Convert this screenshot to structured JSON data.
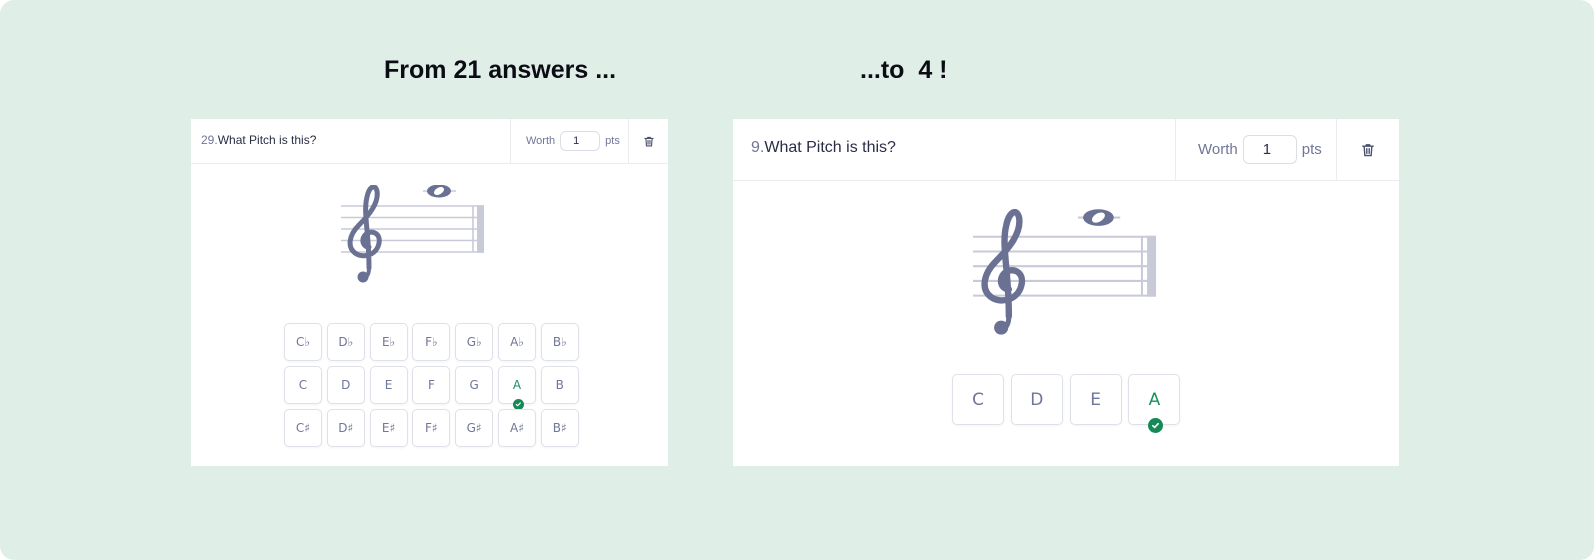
{
  "headings": {
    "left": "From 21 answers ...",
    "right": "...to  4 !"
  },
  "left_card": {
    "question_number": "29.",
    "question_text": "What Pitch is this?",
    "worth_label": "Worth",
    "worth_value": "1",
    "pts_label": "pts",
    "answers": [
      {
        "label": "C♭",
        "correct": false
      },
      {
        "label": "D♭",
        "correct": false
      },
      {
        "label": "E♭",
        "correct": false
      },
      {
        "label": "F♭",
        "correct": false
      },
      {
        "label": "G♭",
        "correct": false
      },
      {
        "label": "A♭",
        "correct": false
      },
      {
        "label": "B♭",
        "correct": false
      },
      {
        "label": "C",
        "correct": false
      },
      {
        "label": "D",
        "correct": false
      },
      {
        "label": "E",
        "correct": false
      },
      {
        "label": "F",
        "correct": false
      },
      {
        "label": "G",
        "correct": false
      },
      {
        "label": "A",
        "correct": true
      },
      {
        "label": "B",
        "correct": false
      },
      {
        "label": "C♯",
        "correct": false
      },
      {
        "label": "D♯",
        "correct": false
      },
      {
        "label": "E♯",
        "correct": false
      },
      {
        "label": "F♯",
        "correct": false
      },
      {
        "label": "G♯",
        "correct": false
      },
      {
        "label": "A♯",
        "correct": false
      },
      {
        "label": "B♯",
        "correct": false
      }
    ]
  },
  "right_card": {
    "question_number": "9.",
    "question_text": "What Pitch is this?",
    "worth_label": "Worth",
    "worth_value": "1",
    "pts_label": "pts",
    "answers": [
      {
        "label": "C",
        "correct": false
      },
      {
        "label": "D",
        "correct": false
      },
      {
        "label": "E",
        "correct": false
      },
      {
        "label": "A",
        "correct": true
      }
    ]
  },
  "icons": {
    "delete": "trash-icon",
    "correct": "check-circle-icon",
    "clef": "treble-clef-icon",
    "note": "whole-note-icon"
  },
  "colors": {
    "background": "#e0eee8",
    "card": "#ffffff",
    "notation": "#6a7193",
    "staff_lines": "#c9cad8",
    "correct": "#158a57",
    "muted_text": "#6f7698"
  }
}
